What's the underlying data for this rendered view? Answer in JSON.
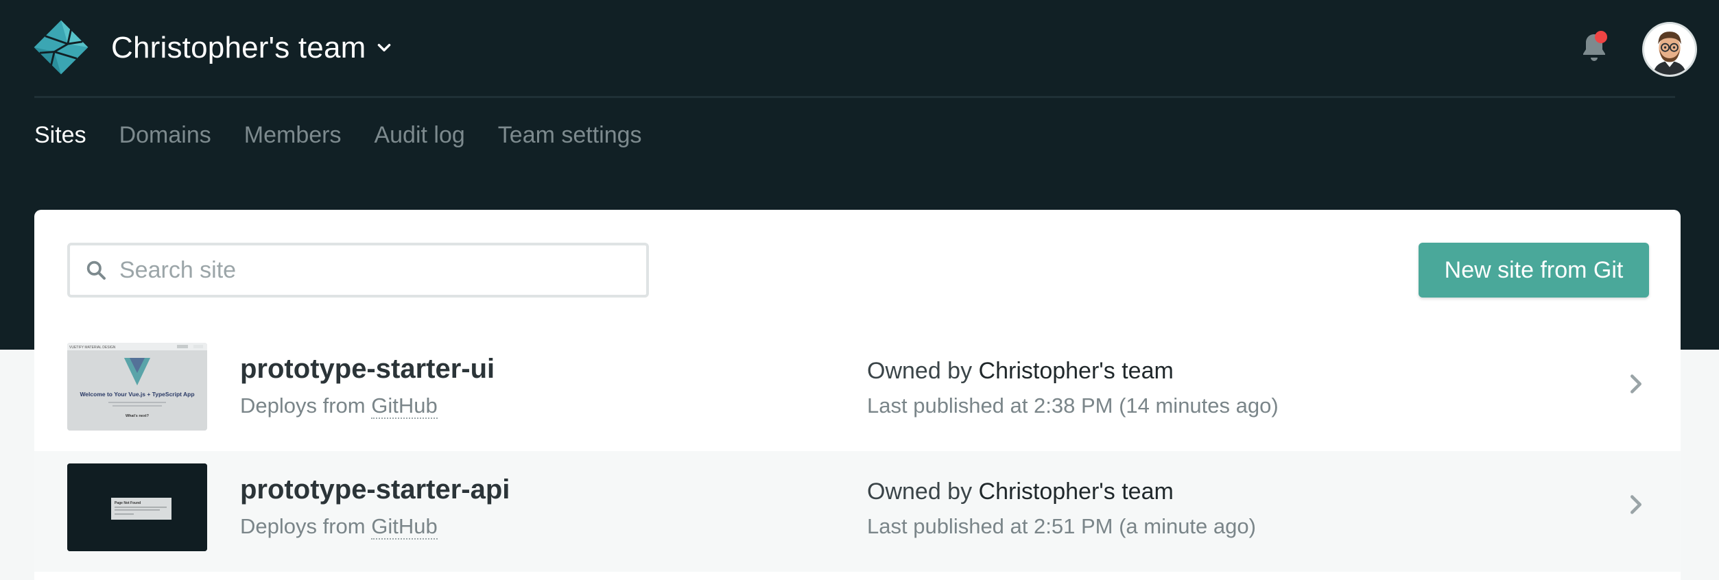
{
  "header": {
    "team_name": "Christopher's team"
  },
  "nav": {
    "items": [
      {
        "label": "Sites",
        "active": true
      },
      {
        "label": "Domains",
        "active": false
      },
      {
        "label": "Members",
        "active": false
      },
      {
        "label": "Audit log",
        "active": false
      },
      {
        "label": "Team settings",
        "active": false
      }
    ]
  },
  "search": {
    "placeholder": "Search site",
    "value": ""
  },
  "new_site_button": "New site from Git",
  "sites": [
    {
      "name": "prototype-starter-ui",
      "deploys_prefix": "Deploys from",
      "deploys_source": "GitHub",
      "owned_prefix": "Owned by",
      "owned_team": "Christopher's team",
      "published": "Last published at 2:38 PM (14 minutes ago)",
      "thumbnail": {
        "brand": "VUETIFY MATERIAL DESIGN",
        "heading": "Welcome to Your Vue.js + TypeScript App",
        "link": "What's next?"
      }
    },
    {
      "name": "prototype-starter-api",
      "deploys_prefix": "Deploys from",
      "deploys_source": "GitHub",
      "owned_prefix": "Owned by",
      "owned_team": "Christopher's team",
      "published": "Last published at 2:51 PM (a minute ago)",
      "thumbnail": {
        "heading": "Page Not Found"
      }
    }
  ],
  "colors": {
    "header_bg": "#112025",
    "accent": "#4aa89a",
    "notification_dot": "#ef4444"
  },
  "icons": [
    "netlify-logo-icon",
    "chevron-down-icon",
    "bell-icon",
    "search-icon",
    "chevron-right-icon"
  ]
}
